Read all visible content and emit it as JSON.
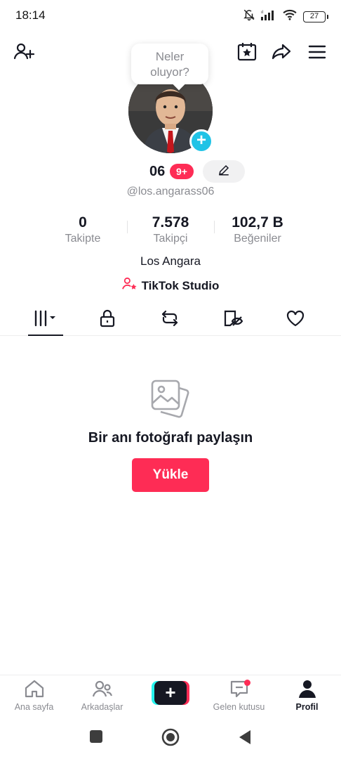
{
  "status_bar": {
    "time": "18:14",
    "battery": "27",
    "icons": [
      "mute-bell-icon",
      "signal-icon",
      "wifi-icon",
      "battery-icon"
    ]
  },
  "top_nav": {
    "icons": [
      "add-friend-icon",
      "calendar-star-icon",
      "share-icon",
      "menu-icon"
    ]
  },
  "profile": {
    "bubble_text_line1": "Neler",
    "bubble_text_line2": "oluyor?",
    "nickname": "06",
    "notification_badge": "9+",
    "username": "@los.angarass06",
    "display_name": "Los Angara",
    "studio_label": "TikTok Studio"
  },
  "stats": [
    {
      "value": "0",
      "label": "Takipte"
    },
    {
      "value": "7.578",
      "label": "Takipçi"
    },
    {
      "value": "102,7 B",
      "label": "Beğeniler"
    }
  ],
  "tabs": [
    "videos-grid-icon",
    "lock-icon",
    "repost-icon",
    "hidden-tag-icon",
    "heart-icon"
  ],
  "empty_state": {
    "message": "Bir anı fotoğrafı paylaşın",
    "button_label": "Yükle"
  },
  "bottom_nav": [
    {
      "label": "Ana sayfa",
      "icon": "home-icon",
      "active": false
    },
    {
      "label": "Arkadaşlar",
      "icon": "friends-icon",
      "active": false
    },
    {
      "label": "",
      "icon": "create-icon",
      "active": false
    },
    {
      "label": "Gelen kutusu",
      "icon": "inbox-icon",
      "active": false
    },
    {
      "label": "Profil",
      "icon": "profile-icon",
      "active": true
    }
  ],
  "colors": {
    "accent": "#fe2c55",
    "cyan": "#25f4ee",
    "avatar_plus": "#20c3e6",
    "text_primary": "#161823",
    "text_secondary": "#8a8b91"
  }
}
